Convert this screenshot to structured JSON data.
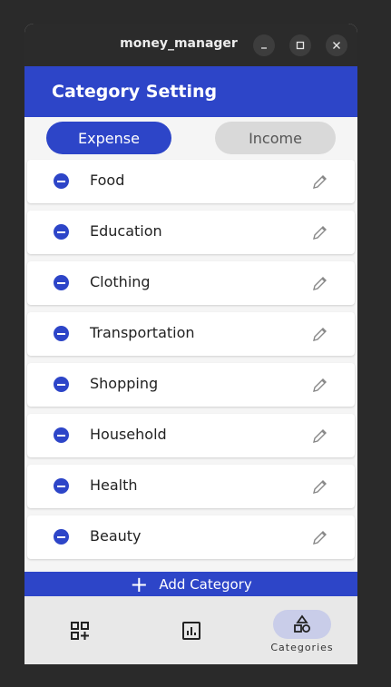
{
  "window": {
    "title": "money_manager"
  },
  "appbar": {
    "title": "Category Setting"
  },
  "tabs": {
    "expense": "Expense",
    "income": "Income"
  },
  "categories": [
    "Food",
    "Education",
    "Clothing",
    "Transportation",
    "Shopping",
    "Household",
    "Health",
    "Beauty"
  ],
  "add_button": {
    "label": "Add Category"
  },
  "bottom_nav": {
    "active_label": "Categories"
  },
  "colors": {
    "accent": "#2d45c8",
    "titlebar": "#2b2b2b",
    "nav_pill": "#c9cde9"
  }
}
